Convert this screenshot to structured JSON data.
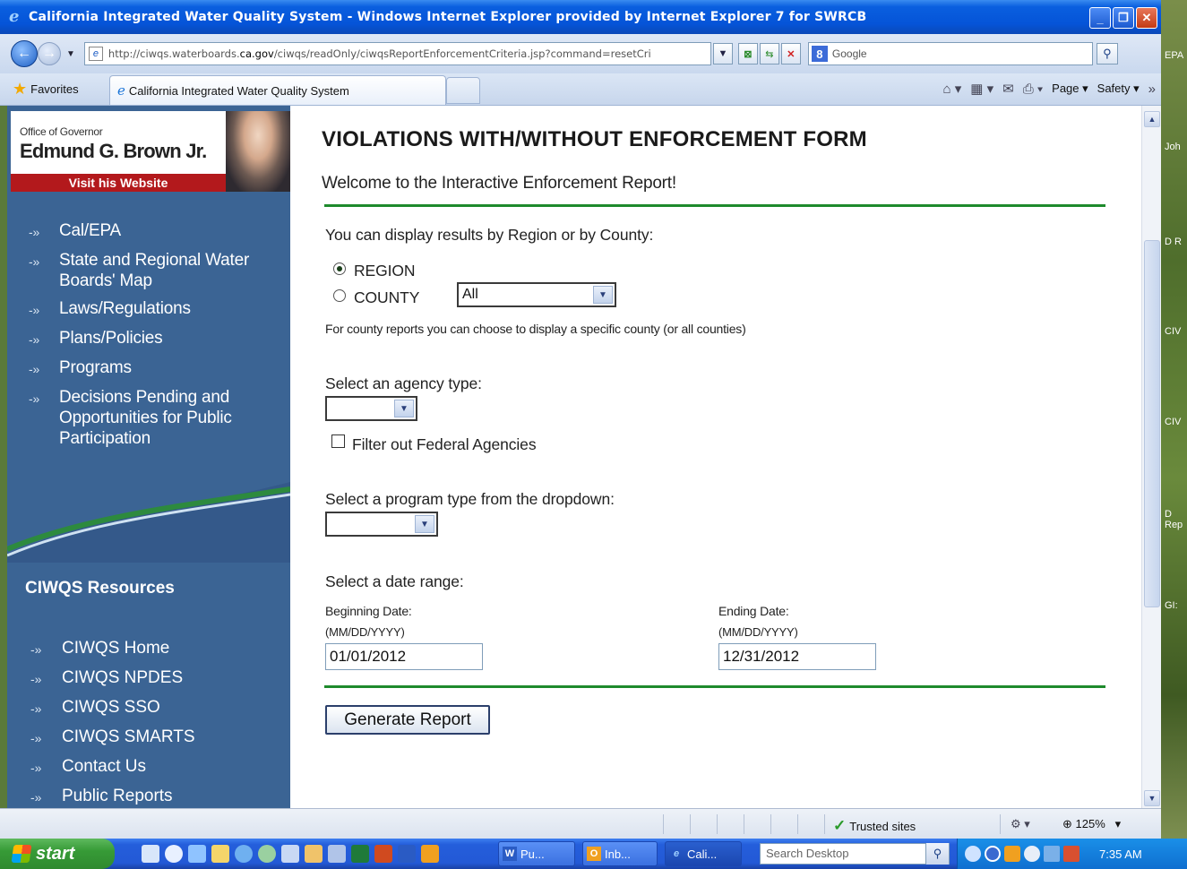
{
  "window": {
    "title": "California Integrated Water Quality System - Windows Internet Explorer provided by Internet Explorer 7 for SWRCB"
  },
  "browser": {
    "url_prefix": "http://ciwqs.waterboards.",
    "url_domain": "ca.gov",
    "url_suffix": "/ciwqs/readOnly/ciwqsReportEnforcementCriteria.jsp?command=resetCri",
    "search_placeholder": "Google",
    "favorites_label": "Favorites",
    "tab_title": "California Integrated Water Quality System",
    "page_menu": "Page ▾",
    "safety_menu": "Safety ▾"
  },
  "sidebar": {
    "office_label": "Office of Governor",
    "governor_name": "Edmund G. Brown Jr.",
    "visit_label": "Visit his Website",
    "nav": [
      {
        "label": "Cal/EPA"
      },
      {
        "label": "State and Regional Water Boards' Map"
      },
      {
        "label": "Laws/Regulations"
      },
      {
        "label": "Plans/Policies"
      },
      {
        "label": "Programs"
      },
      {
        "label": "Decisions Pending and Opportunities for Public Participation"
      }
    ],
    "resources_title": "CIWQS Resources",
    "resources": [
      {
        "label": "CIWQS Home"
      },
      {
        "label": "CIWQS NPDES"
      },
      {
        "label": "CIWQS SSO"
      },
      {
        "label": "CIWQS SMARTS"
      },
      {
        "label": "Contact Us"
      },
      {
        "label": "Public Reports"
      }
    ]
  },
  "form": {
    "title": "VIOLATIONS WITH/WITHOUT ENFORCEMENT FORM",
    "welcome": "Welcome to the Interactive Enforcement Report!",
    "display_by_label": "You can display results by Region or by County:",
    "region_label": "REGION",
    "county_label": "COUNTY",
    "county_select_value": "All",
    "county_note": "For county reports you can choose to display a specific county (or all counties)",
    "agency_label": "Select an agency type:",
    "agency_value": "",
    "filter_federal_label": "Filter out Federal Agencies",
    "program_label": "Select a program type from the dropdown:",
    "program_value": "",
    "date_range_label": "Select a date range:",
    "begin_label": "Beginning Date:",
    "begin_format": "(MM/DD/YYYY)",
    "begin_value": "01/01/2012",
    "end_label": "Ending Date:",
    "end_format": "(MM/DD/YYYY)",
    "end_value": "12/31/2012",
    "generate_label": "Generate Report",
    "region_checked": true
  },
  "status": {
    "zone": "Trusted sites",
    "zoom": "125%"
  },
  "taskbar": {
    "start_label": "start",
    "tasks": [
      {
        "label": "Pu..."
      },
      {
        "label": "Inb..."
      },
      {
        "label": "Cali..."
      }
    ],
    "search_placeholder": "Search Desktop",
    "clock": "7:35 AM"
  },
  "desktop": {
    "icon_labels": [
      "EPA",
      "Joh",
      "D R",
      "CIV",
      "CIV",
      "D Rep",
      "GI:"
    ]
  },
  "colors": {
    "sidebar_bg": "#3b6494",
    "rule_green": "#1e8a2c",
    "visit_red": "#b3191c"
  }
}
